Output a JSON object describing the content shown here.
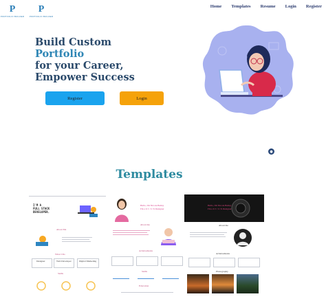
{
  "header": {
    "logos": [
      {
        "mark": "P",
        "sub": "PORTFOLIO BUILDER"
      },
      {
        "mark": "P",
        "sub": "PORTFOLIO BUILDER"
      }
    ],
    "nav": [
      "Home",
      "Templates",
      "Resume",
      "Login",
      "Register"
    ]
  },
  "hero": {
    "line1": "Build Custom",
    "line2": "Portfolio",
    "line3": "for your Career,",
    "line4": "Empower Success",
    "register_label": "Register",
    "login_label": "Login"
  },
  "templates": {
    "title": "Templates",
    "t1": {
      "hero_text": "I'M A\nFULL STACK\nDEVELOPER.",
      "about": "About Me",
      "skills": "What I Do",
      "cards": [
        "Designer",
        "Web Developer",
        "Digital Marketing"
      ],
      "projects": "Skills"
    },
    "t2": {
      "hero_text": "Hello, I'm Nicole Bailey\nI'm a U I / U X Designer",
      "about": "About me",
      "achievements": "Achievements",
      "skills": "Skills",
      "contact": "Education"
    },
    "t3": {
      "hero_text": "Hello, I'm Nicole Bailey\nI'm a U I / U X Designer",
      "about": "About me",
      "achievements": "Achievements",
      "gallery": "Photography"
    }
  },
  "colors": {
    "brand": "#2c7fb8",
    "title": "#2b4a6b",
    "accent": "#2e86b5",
    "register": "#1aa3ee",
    "login": "#f5a20a",
    "section_title": "#2e8ba0",
    "blob": "#a8b1ef"
  }
}
